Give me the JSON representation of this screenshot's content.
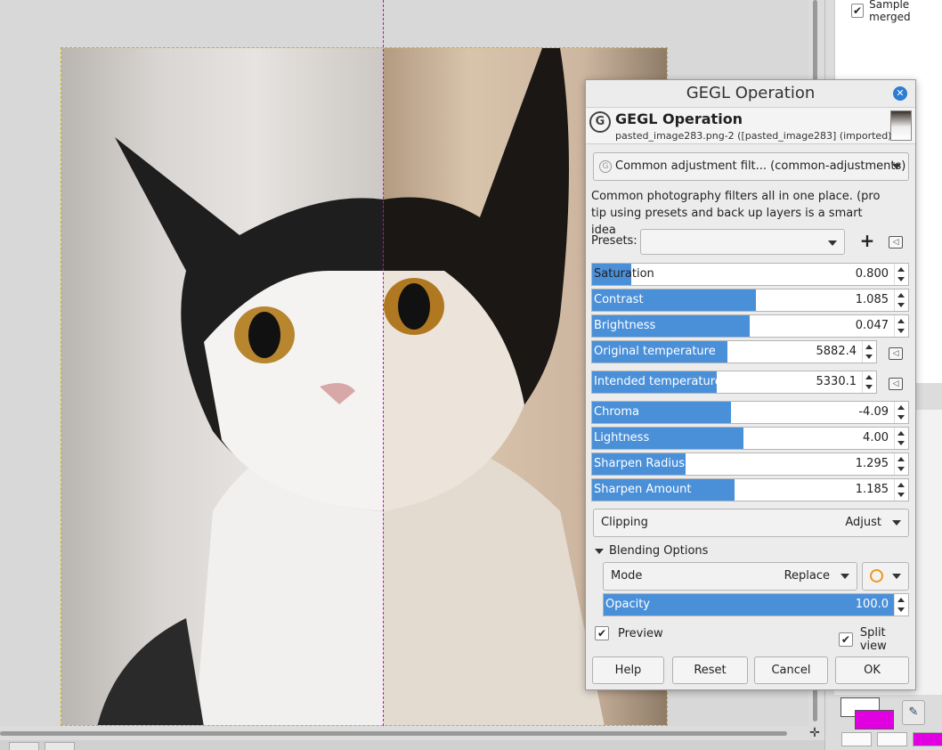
{
  "dialog": {
    "window_title": "GEGL Operation",
    "header_title": "GEGL Operation",
    "header_subtitle": "pasted_image283.png-2 ([pasted_image283] (imported))",
    "filter_select": "Common adjustment filt... (common-adjustments)",
    "description": "Common photography filters all in one place. (pro tip using presets and back up layers is a smart idea",
    "presets_label": "Presets:",
    "presets_value": "",
    "sliders": [
      {
        "label": "Saturation",
        "value": "0.800",
        "fraction": 0.13
      },
      {
        "label": "Contrast",
        "value": "1.085",
        "fraction": 0.54
      },
      {
        "label": "Brightness",
        "value": "0.047",
        "fraction": 0.52
      },
      {
        "label": "Original temperature",
        "value": "5882.4",
        "fraction": 0.5
      },
      {
        "label": "Intended temperature",
        "value": "5330.1",
        "fraction": 0.46
      },
      {
        "label": "Chroma",
        "value": "-4.09",
        "fraction": 0.46
      },
      {
        "label": "Lightness",
        "value": "4.00",
        "fraction": 0.5
      },
      {
        "label": "Sharpen Radius",
        "value": "1.295",
        "fraction": 0.31
      },
      {
        "label": "Sharpen Amount",
        "value": "1.185",
        "fraction": 0.47
      }
    ],
    "clipping_label": "Clipping",
    "clipping_value": "Adjust",
    "blending_label": "Blending Options",
    "mode_label": "Mode",
    "mode_value": "Replace",
    "opacity_label": "Opacity",
    "opacity_value": "100.0",
    "opacity_fraction": 1.0,
    "preview_label": "Preview",
    "preview_checked": true,
    "split_view_label": "Split view",
    "split_view_checked": true,
    "buttons": {
      "help": "Help",
      "reset": "Reset",
      "cancel": "Cancel",
      "ok": "OK"
    }
  },
  "dock": {
    "sample_merged_label": "Sample merged",
    "sample_merged_checked": true,
    "foreground_color": "#ffffff",
    "background_color": "#e000e0"
  },
  "colors": {
    "accent": "#4a90d9",
    "guide": "#d000d0"
  }
}
